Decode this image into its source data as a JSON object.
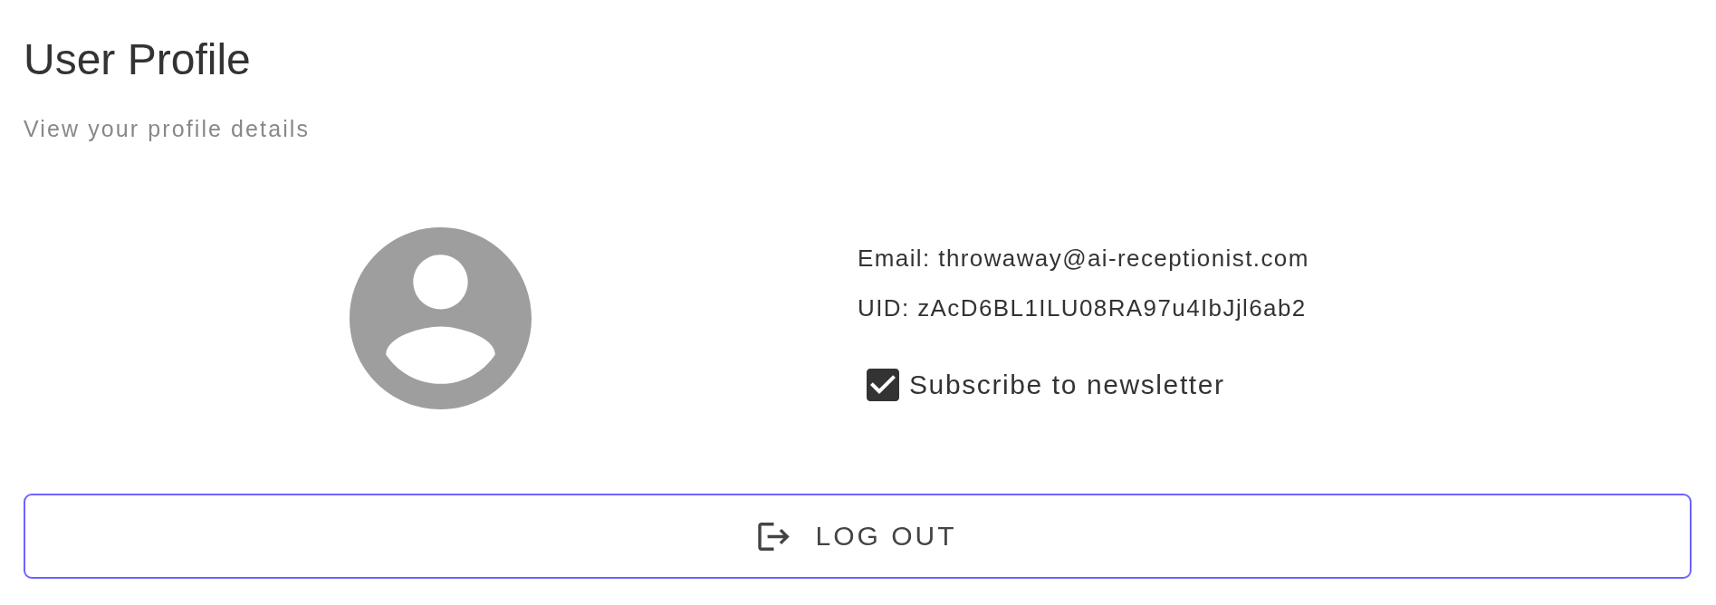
{
  "header": {
    "title": "User Profile",
    "subtitle": "View your profile details"
  },
  "profile": {
    "email_line": "Email: throwaway@ai-receptionist.com",
    "uid_line": "UID: zAcD6BL1ILU08RA97u4IbJjl6ab2"
  },
  "newsletter": {
    "label": "Subscribe to newsletter",
    "checked": true
  },
  "logout_button": {
    "label": "LOG OUT"
  }
}
